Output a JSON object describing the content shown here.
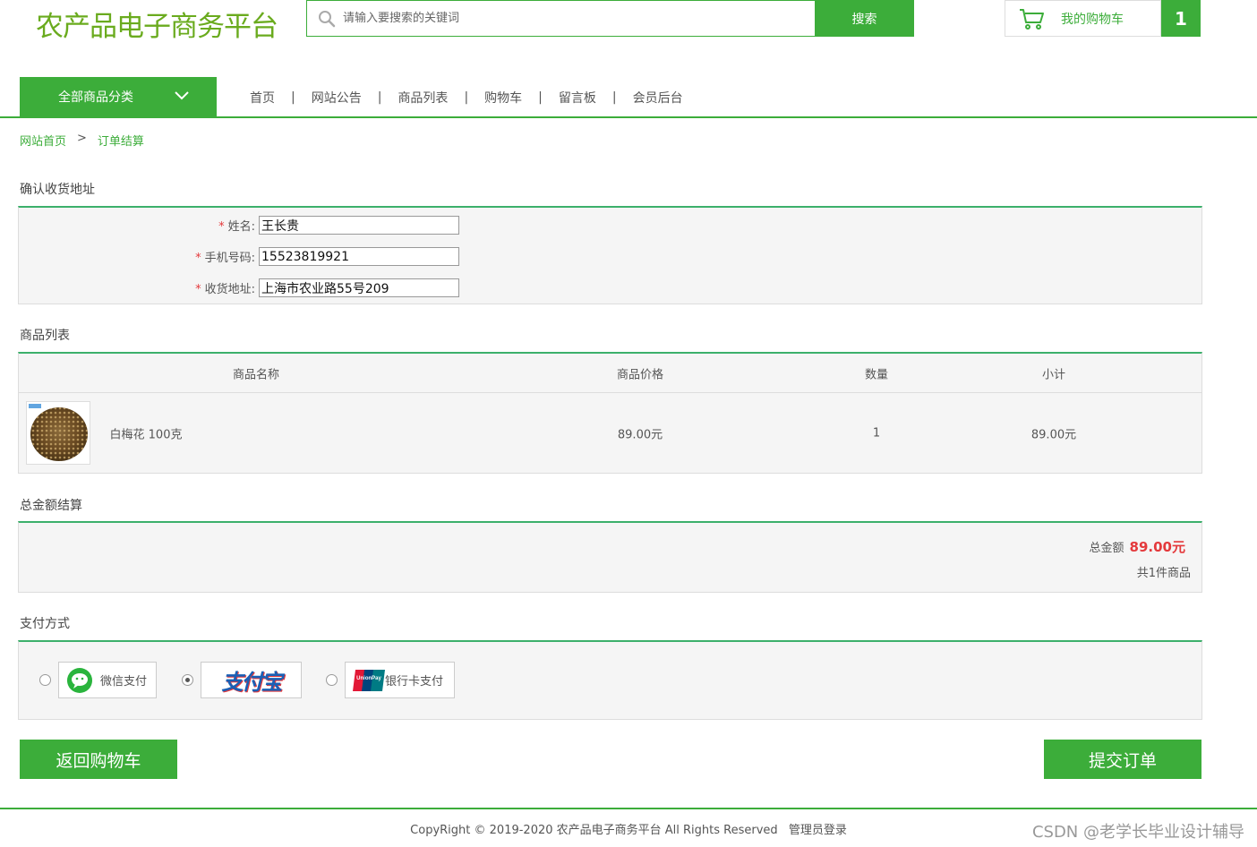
{
  "header": {
    "logo_text": "农产品电子商务平台",
    "search_placeholder": "请输入要搜索的关键词",
    "search_button": "搜索",
    "cart_label": "我的购物车",
    "cart_count": "1"
  },
  "nav": {
    "category_button": "全部商品分类",
    "items": [
      "首页",
      "网站公告",
      "商品列表",
      "购物车",
      "留言板",
      "会员后台"
    ],
    "separator": "|"
  },
  "breadcrumb": {
    "home": "网站首页",
    "arrow": ">",
    "current": "订单结算"
  },
  "address": {
    "title": "确认收货地址",
    "name_label": "姓名:",
    "name_value": "王长贵",
    "phone_label": "手机号码:",
    "phone_value": "15523819921",
    "address_label": "收货地址:",
    "address_value": "上海市农业路55号209",
    "required_mark": "*"
  },
  "products": {
    "title": "商品列表",
    "columns": [
      "商品名称",
      "商品价格",
      "数量",
      "小计"
    ],
    "rows": [
      {
        "name": "白梅花 100克",
        "price": "89.00元",
        "qty": "1",
        "subtotal": "89.00元"
      }
    ]
  },
  "total": {
    "title": "总金额结算",
    "label": "总金额",
    "amount": "89.00元",
    "count_text": "共1件商品"
  },
  "payment": {
    "title": "支付方式",
    "options": [
      {
        "label": "微信支付",
        "selected": false
      },
      {
        "label": "支付宝",
        "selected": true
      },
      {
        "label": "银行卡支付",
        "selected": false
      }
    ],
    "unionpay_logo_text": "UnionPay"
  },
  "actions": {
    "back": "返回购物车",
    "submit": "提交订单"
  },
  "footer": {
    "copyright": "CopyRight © 2019-2020 农产品电子商务平台 All Rights Reserved",
    "admin_link": "管理员登录"
  },
  "watermark": "CSDN @老学长毕业设计辅导",
  "colors": {
    "brand_green": "#3cad3a",
    "logo_green": "#6aab1e",
    "price_red": "#e4393c",
    "panel_border": "#3cb06b"
  }
}
